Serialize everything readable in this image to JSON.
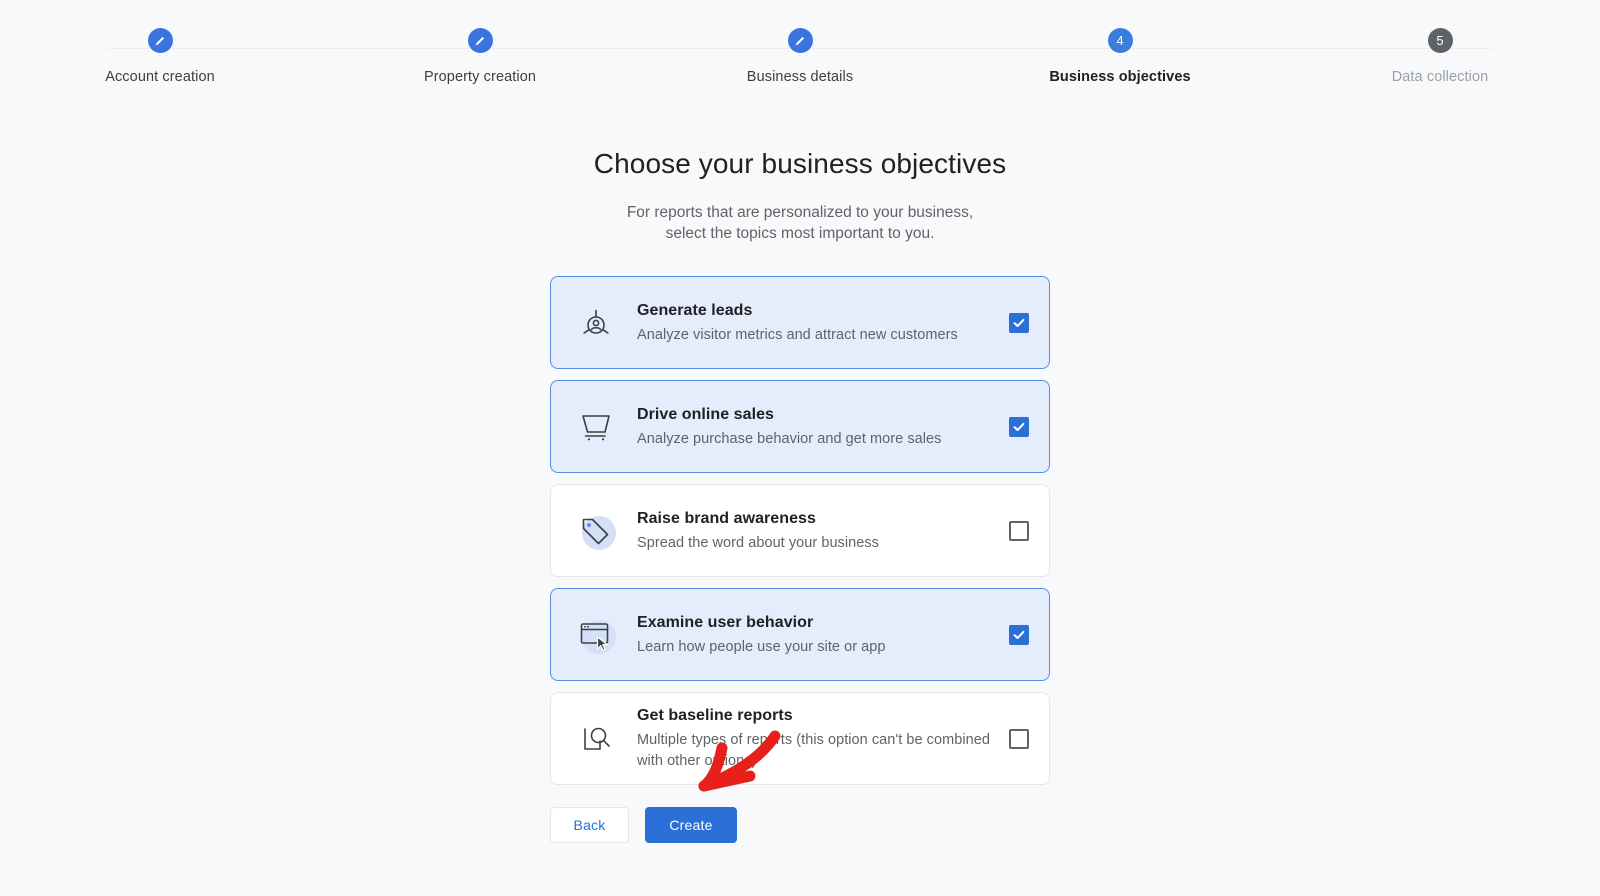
{
  "stepper": {
    "steps": [
      {
        "label": "Account creation",
        "state": "done",
        "marker": "edit-pencil"
      },
      {
        "label": "Property creation",
        "state": "done",
        "marker": "edit-pencil"
      },
      {
        "label": "Business details",
        "state": "done",
        "marker": "edit-pencil"
      },
      {
        "label": "Business objectives",
        "state": "active",
        "marker": "4"
      },
      {
        "label": "Data collection",
        "state": "pending",
        "marker": "5"
      }
    ]
  },
  "page": {
    "title": "Choose your business objectives",
    "subtitle_line1": "For reports that are personalized to your business,",
    "subtitle_line2": "select the topics most important to you."
  },
  "objectives": [
    {
      "title": "Generate leads",
      "description": "Analyze visitor metrics and attract new customers",
      "icon": "lead-target-person-icon",
      "checked": true
    },
    {
      "title": "Drive online sales",
      "description": "Analyze purchase behavior and get more sales",
      "icon": "shopping-cart-icon",
      "checked": true
    },
    {
      "title": "Raise brand awareness",
      "description": "Spread the word about your business",
      "icon": "price-tag-icon",
      "checked": false
    },
    {
      "title": "Examine user behavior",
      "description": "Learn how people use your site or app",
      "icon": "browser-window-cursor-icon",
      "checked": true
    },
    {
      "title": "Get baseline reports",
      "description": "Multiple types of reports (this option can't be combined with other options)",
      "icon": "magnifier-document-icon",
      "checked": false
    }
  ],
  "footer": {
    "back_label": "Back",
    "create_label": "Create"
  },
  "annotation": {
    "type": "hand-drawn-arrow",
    "color": "#e8201b",
    "points_to": "Create"
  },
  "colors": {
    "page_background": "#f8f9fa",
    "accent_blue": "#2b6fd8",
    "selected_card_background": "#e5ecfb",
    "selected_card_border": "#5b8dea",
    "card_border": "#e4e6e9",
    "title_text": "#202124",
    "secondary_text": "#5f6368",
    "pending_step": "#5f6368",
    "annotation_red": "#e8201b"
  }
}
